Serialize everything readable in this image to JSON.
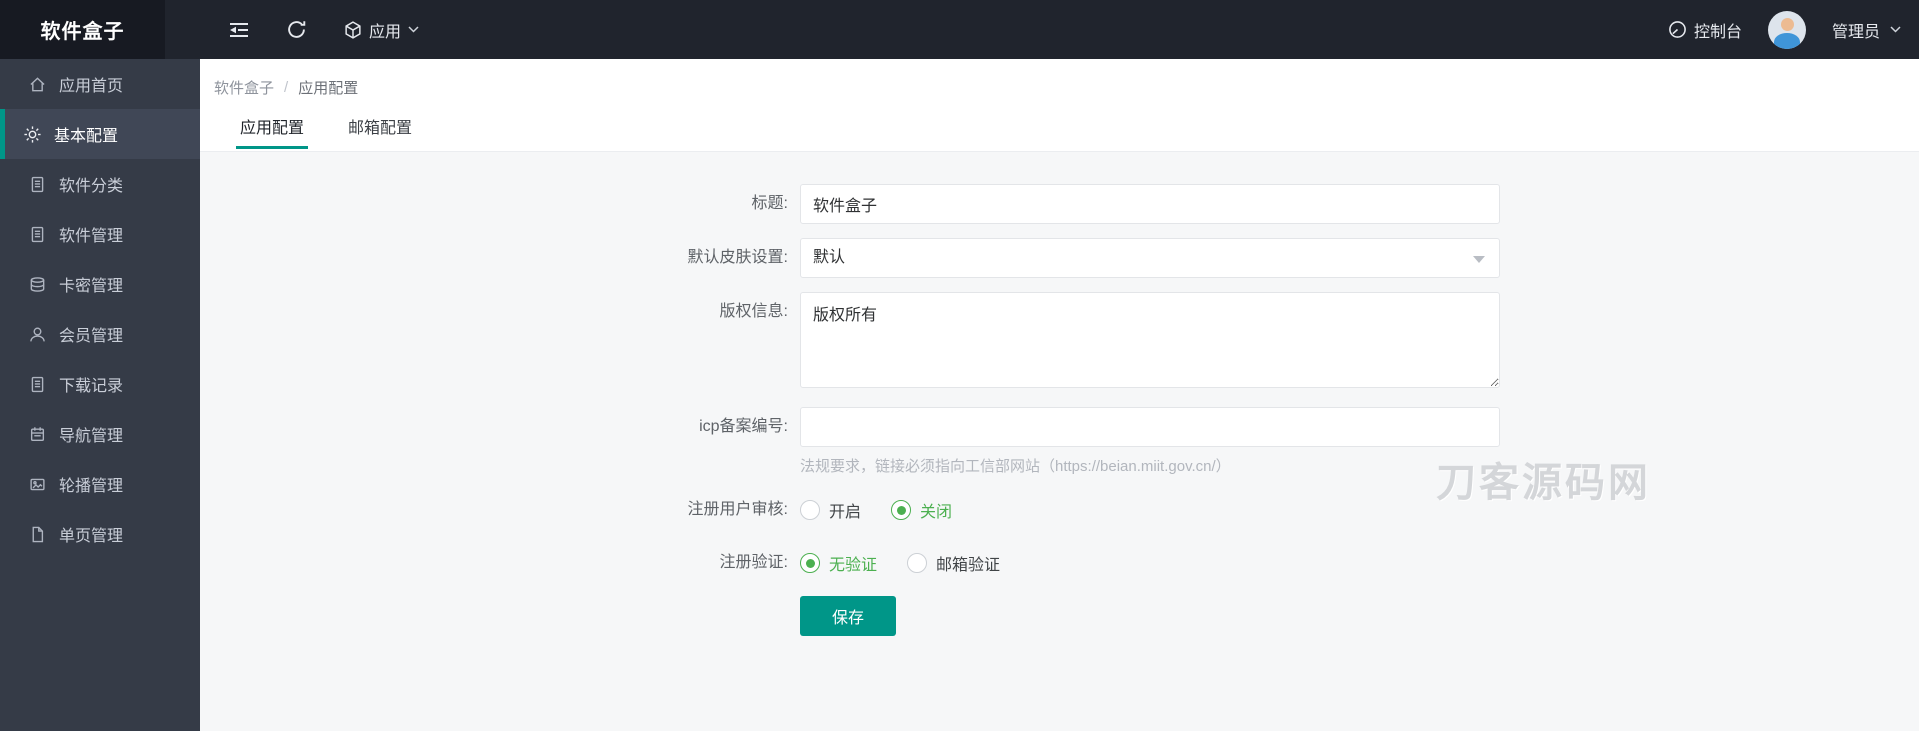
{
  "topbar": {
    "logo": "软件盒子",
    "app_label": "应用",
    "console_label": "控制台",
    "user_label": "管理员"
  },
  "breadcrumb": {
    "root": "软件盒子",
    "separator": "/",
    "current": "应用配置"
  },
  "tabs": [
    {
      "label": "应用配置",
      "active": true
    },
    {
      "label": "邮箱配置",
      "active": false
    }
  ],
  "sidebar": {
    "items": [
      {
        "label": "应用首页",
        "icon": "home-icon",
        "active": false
      },
      {
        "label": "基本配置",
        "icon": "gear-icon",
        "active": true
      },
      {
        "label": "软件分类",
        "icon": "document-icon",
        "active": false
      },
      {
        "label": "软件管理",
        "icon": "document-icon",
        "active": false
      },
      {
        "label": "卡密管理",
        "icon": "database-icon",
        "active": false
      },
      {
        "label": "会员管理",
        "icon": "user-icon",
        "active": false
      },
      {
        "label": "下载记录",
        "icon": "document-icon",
        "active": false
      },
      {
        "label": "导航管理",
        "icon": "calendar-icon",
        "active": false
      },
      {
        "label": "轮播管理",
        "icon": "image-icon",
        "active": false
      },
      {
        "label": "单页管理",
        "icon": "page-icon",
        "active": false
      }
    ]
  },
  "form": {
    "title_label": "标题:",
    "title_value": "软件盒子",
    "skin_label": "默认皮肤设置:",
    "skin_value": "默认",
    "copyright_label": "版权信息:",
    "copyright_value": "版权所有",
    "icp_label": "icp备案编号:",
    "icp_value": "",
    "icp_hint": "法规要求，链接必须指向工信部网站（https://beian.miit.gov.cn/）",
    "audit_label": "注册用户审核:",
    "audit_options": [
      {
        "label": "开启",
        "selected": false
      },
      {
        "label": "关闭",
        "selected": true
      }
    ],
    "verify_label": "注册验证:",
    "verify_options": [
      {
        "label": "无验证",
        "selected": true
      },
      {
        "label": "邮箱验证",
        "selected": false
      }
    ],
    "save_label": "保存"
  },
  "watermark": "刀客源码网",
  "colors": {
    "accent_teal": "#009688",
    "radio_green": "#4cb050",
    "topbar_bg": "#20242d",
    "logo_bg": "#171a22",
    "sidebar_bg": "#353b47",
    "content_bg": "#f6f7f8"
  }
}
